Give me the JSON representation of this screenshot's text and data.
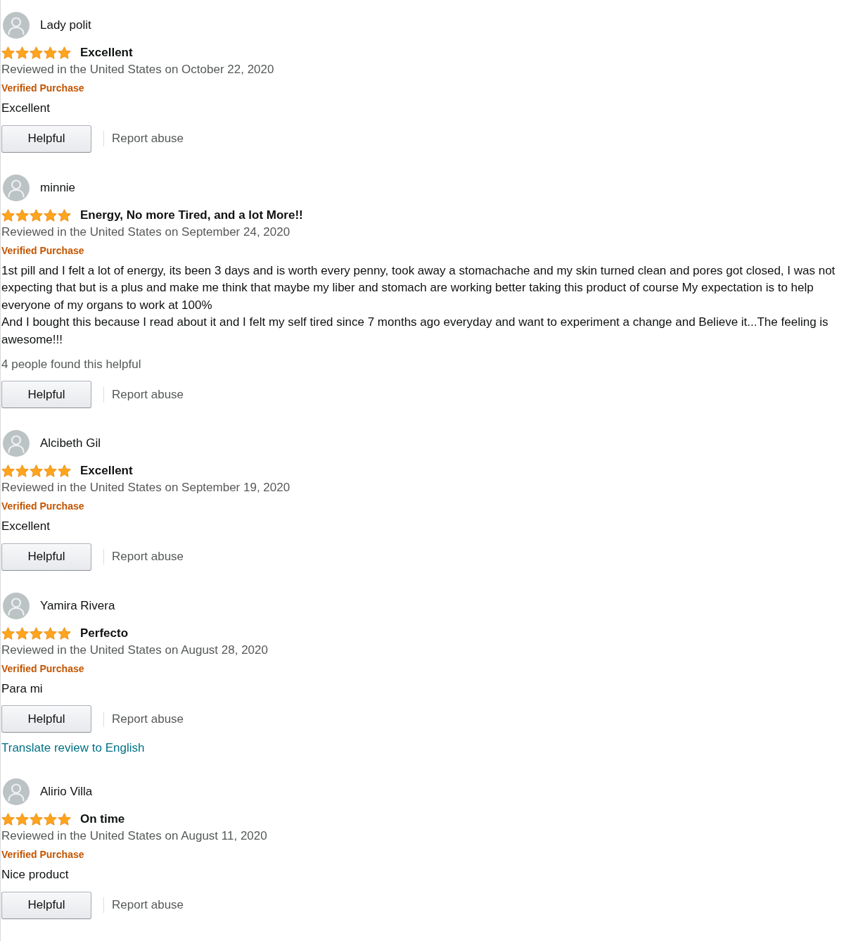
{
  "reviews": [
    {
      "author": "Lady polit",
      "stars": 5,
      "title": "Excellent",
      "date": "Reviewed in the United States on October 22, 2020",
      "badge": "Verified Purchase",
      "body": [
        "Excellent"
      ],
      "helpful_button": "Helpful",
      "report_link": "Report abuse"
    },
    {
      "author": "minnie",
      "stars": 5,
      "title": "Energy, No more Tired, and a lot More!!",
      "date": "Reviewed in the United States on September 24, 2020",
      "badge": "Verified Purchase",
      "body": [
        "1st pill and I felt a lot of energy, its been 3 days and is worth every penny, took away a stomachache and my skin turned clean and pores got closed, I was not expecting that but is a plus and make me think that maybe my liber and stomach are working better taking this product of course My expectation is to help everyone of my organs to work at 100%",
        "And I bought this because I read about it and I felt my self tired since 7 months ago everyday and want to experiment a change and Believe it...The feeling is awesome!!!"
      ],
      "helpful_note": "4 people found this helpful",
      "helpful_button": "Helpful",
      "report_link": "Report abuse"
    },
    {
      "author": "Alcibeth Gil",
      "stars": 5,
      "title": "Excellent",
      "date": "Reviewed in the United States on September 19, 2020",
      "badge": "Verified Purchase",
      "body": [
        "Excellent"
      ],
      "helpful_button": "Helpful",
      "report_link": "Report abuse"
    },
    {
      "author": "Yamira Rivera",
      "stars": 5,
      "title": "Perfecto",
      "date": "Reviewed in the United States on August 28, 2020",
      "badge": "Verified Purchase",
      "body": [
        "Para mi"
      ],
      "helpful_button": "Helpful",
      "report_link": "Report abuse",
      "translate_link": "Translate review to English"
    },
    {
      "author": "Alirio Villa",
      "stars": 5,
      "title": "On time",
      "date": "Reviewed in the United States on August 11, 2020",
      "badge": "Verified Purchase",
      "body": [
        "Nice product"
      ],
      "helpful_button": "Helpful",
      "report_link": "Report abuse"
    }
  ]
}
